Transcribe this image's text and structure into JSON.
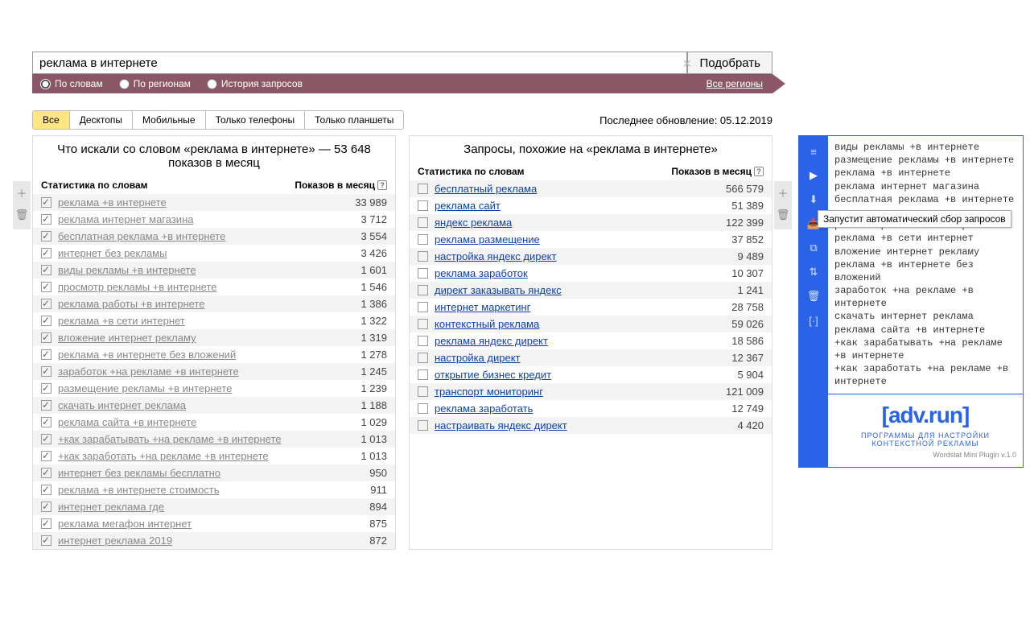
{
  "search": {
    "value": "реклама в интернете",
    "submit": "Подобрать"
  },
  "radios": {
    "words": "По словам",
    "regions": "По регионам",
    "history": "История запросов"
  },
  "all_regions": "Все регионы",
  "devices": {
    "all": "Все",
    "desk": "Десктопы",
    "mob": "Мобильные",
    "phone": "Только телефоны",
    "tablet": "Только планшеты"
  },
  "last_update": "Последнее обновление: 05.12.2019",
  "left": {
    "title": "Что искали со словом «реклама в интернете» — 53 648 показов в месяц",
    "h1": "Статистика по словам",
    "h2": "Показов в месяц",
    "rows": [
      {
        "q": "реклама +в интернете",
        "n": "33 989"
      },
      {
        "q": "реклама интернет магазина",
        "n": "3 712"
      },
      {
        "q": "бесплатная реклама +в интернете",
        "n": "3 554"
      },
      {
        "q": "интернет без рекламы",
        "n": "3 426"
      },
      {
        "q": "виды рекламы +в интернете",
        "n": "1 601"
      },
      {
        "q": "просмотр рекламы +в интернете",
        "n": "1 546"
      },
      {
        "q": "реклама работы +в интернете",
        "n": "1 386"
      },
      {
        "q": "реклама +в сети интернет",
        "n": "1 322"
      },
      {
        "q": "вложение интернет рекламу",
        "n": "1 319"
      },
      {
        "q": "реклама +в интернете без вложений",
        "n": "1 278"
      },
      {
        "q": "заработок +на рекламе +в интернете",
        "n": "1 245"
      },
      {
        "q": "размещение рекламы +в интернете",
        "n": "1 239"
      },
      {
        "q": "скачать интернет реклама",
        "n": "1 188"
      },
      {
        "q": "реклама сайта +в интернете",
        "n": "1 029"
      },
      {
        "q": "+как зарабатывать +на рекламе +в интернете",
        "n": "1 013"
      },
      {
        "q": "+как заработать +на рекламе +в интернете",
        "n": "1 013"
      },
      {
        "q": "интернет без рекламы бесплатно",
        "n": "950"
      },
      {
        "q": "реклама +в интернете стоимость",
        "n": "911"
      },
      {
        "q": "интернет реклама где",
        "n": "894"
      },
      {
        "q": "реклама мегафон интернет",
        "n": "875"
      },
      {
        "q": "интернет реклама 2019",
        "n": "872"
      }
    ]
  },
  "right": {
    "title": "Запросы, похожие на «реклама в интернете»",
    "h1": "Статистика по словам",
    "h2": "Показов в месяц",
    "rows": [
      {
        "q": "бесплатный реклама",
        "n": "566 579"
      },
      {
        "q": "реклама сайт",
        "n": "51 389"
      },
      {
        "q": "яндекс реклама",
        "n": "122 399"
      },
      {
        "q": "реклама размещение",
        "n": "37 852"
      },
      {
        "q": "настройка яндекс директ",
        "n": "9 489"
      },
      {
        "q": "реклама заработок",
        "n": "10 307"
      },
      {
        "q": "директ заказывать яндекс",
        "n": "1 241"
      },
      {
        "q": "интернет маркетинг",
        "n": "28 758"
      },
      {
        "q": "контекстный реклама",
        "n": "59 026"
      },
      {
        "q": "реклама яндекс директ",
        "n": "18 586"
      },
      {
        "q": "настройка директ",
        "n": "12 367"
      },
      {
        "q": "открытие бизнес кредит",
        "n": "5 904"
      },
      {
        "q": "транспорт мониторинг",
        "n": "121 009"
      },
      {
        "q": "реклама заработать",
        "n": "12 749"
      },
      {
        "q": "настраивать яндекс директ",
        "n": "4 420"
      }
    ]
  },
  "plugin": {
    "keys": "виды рекламы +в интернете\nразмещение рекламы +в интернете\nреклама +в интернете\nреклама интернет магазина\nбесплатная реклама +в интернете\n\nреклама работы +в интернете\nреклама +в сети интернет\nвложение интернет рекламу\nреклама +в интернете без вложений\nзаработок +на рекламе +в интернете\nскачать интернет реклама\nреклама сайта +в интернете\n+как зарабатывать +на рекламе +в интернете\n+как заработать +на рекламе +в интернете",
    "tooltip": "Запустит автоматический сбор запросов",
    "logo": "[adv.run]",
    "sub": "ПРОГРАММЫ ДЛЯ НАСТРОЙКИ КОНТЕКСТНОЙ РЕКЛАМЫ",
    "foot": "Wordstat Mini Plugin v.1.0"
  }
}
